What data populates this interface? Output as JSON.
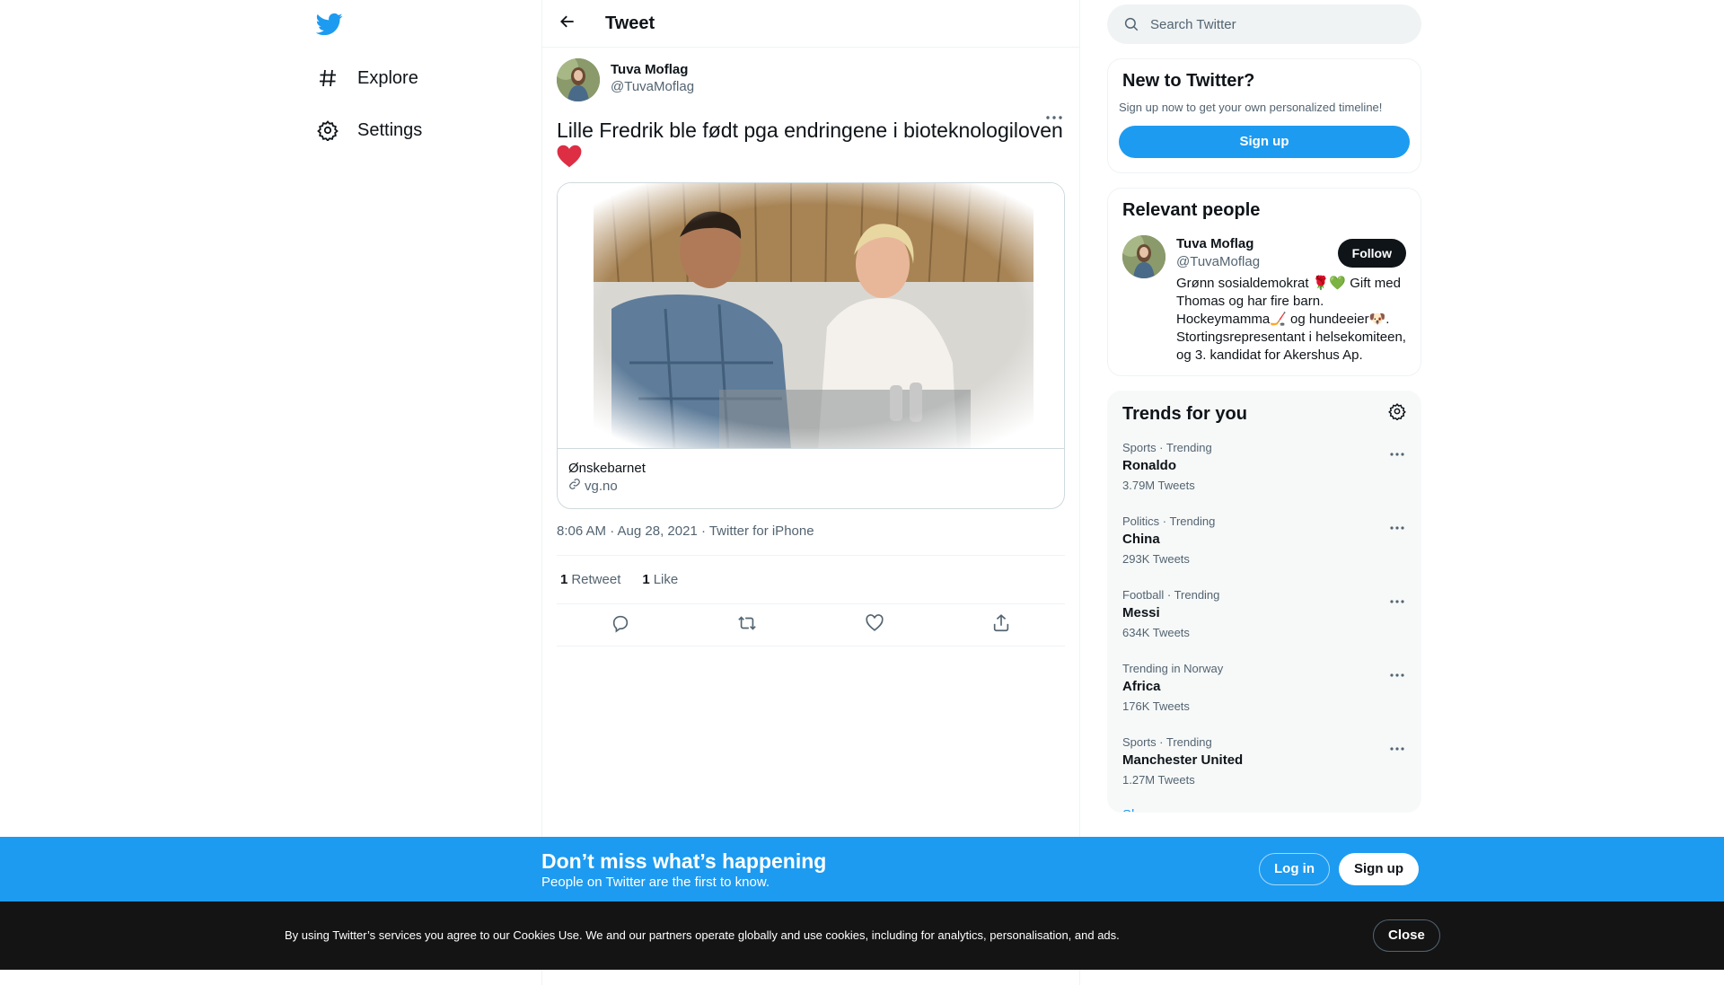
{
  "nav": {
    "logo_icon": "twitter-bird-icon",
    "brand_color": "#1d9bf0",
    "items": [
      {
        "label": "Explore",
        "icon": "hashtag-icon"
      },
      {
        "label": "Settings",
        "icon": "gear-icon"
      }
    ]
  },
  "header": {
    "title": "Tweet",
    "back_icon": "arrow-left-icon"
  },
  "tweet": {
    "author_name": "Tuva Moflag",
    "author_handle": "@TuvaMoflag",
    "text": "Lille Fredrik ble født pga endringene i bioteknologiloven",
    "emoji": "heart",
    "card": {
      "title": "Ønskebarnet",
      "domain": "vg.no"
    },
    "timestamp": "8:06 AM · Aug 28, 2021 · Twitter for iPhone",
    "retweets": {
      "count": "1",
      "label": "Retweet"
    },
    "likes": {
      "count": "1",
      "label": "Like"
    }
  },
  "search": {
    "placeholder": "Search Twitter"
  },
  "new_to_twitter": {
    "title": "New to Twitter?",
    "subtitle": "Sign up now to get your own personalized timeline!",
    "button": "Sign up"
  },
  "relevant_people": {
    "title": "Relevant people",
    "person": {
      "name": "Tuva Moflag",
      "handle": "@TuvaMoflag",
      "bio": "Grønn sosialdemokrat 🌹💚 Gift med Thomas og har fire barn. Hockeymamma🏒 og hundeeier🐶. Stortingsrepresentant i helsekomiteen, og 3. kandidat for Akershus Ap.",
      "follow_label": "Follow"
    }
  },
  "trends": {
    "title": "Trends for you",
    "items": [
      {
        "category": "Sports · Trending",
        "name": "Ronaldo",
        "count": "3.79M Tweets"
      },
      {
        "category": "Politics · Trending",
        "name": "China",
        "count": "293K Tweets"
      },
      {
        "category": "Football · Trending",
        "name": "Messi",
        "count": "634K Tweets"
      },
      {
        "category": "Trending in Norway",
        "name": "Africa",
        "count": "176K Tweets"
      },
      {
        "category": "Sports · Trending",
        "name": "Manchester United",
        "count": "1.27M Tweets"
      }
    ],
    "show_more": "Show more"
  },
  "banner": {
    "title": "Don’t miss what’s happening",
    "subtitle": "People on Twitter are the first to know.",
    "login": "Log in",
    "signup": "Sign up"
  },
  "cookie": {
    "text": "By using Twitter’s services you agree to our Cookies Use. We and our partners operate globally and use cookies, including for analytics, personalisation, and ads.",
    "close": "Close"
  }
}
